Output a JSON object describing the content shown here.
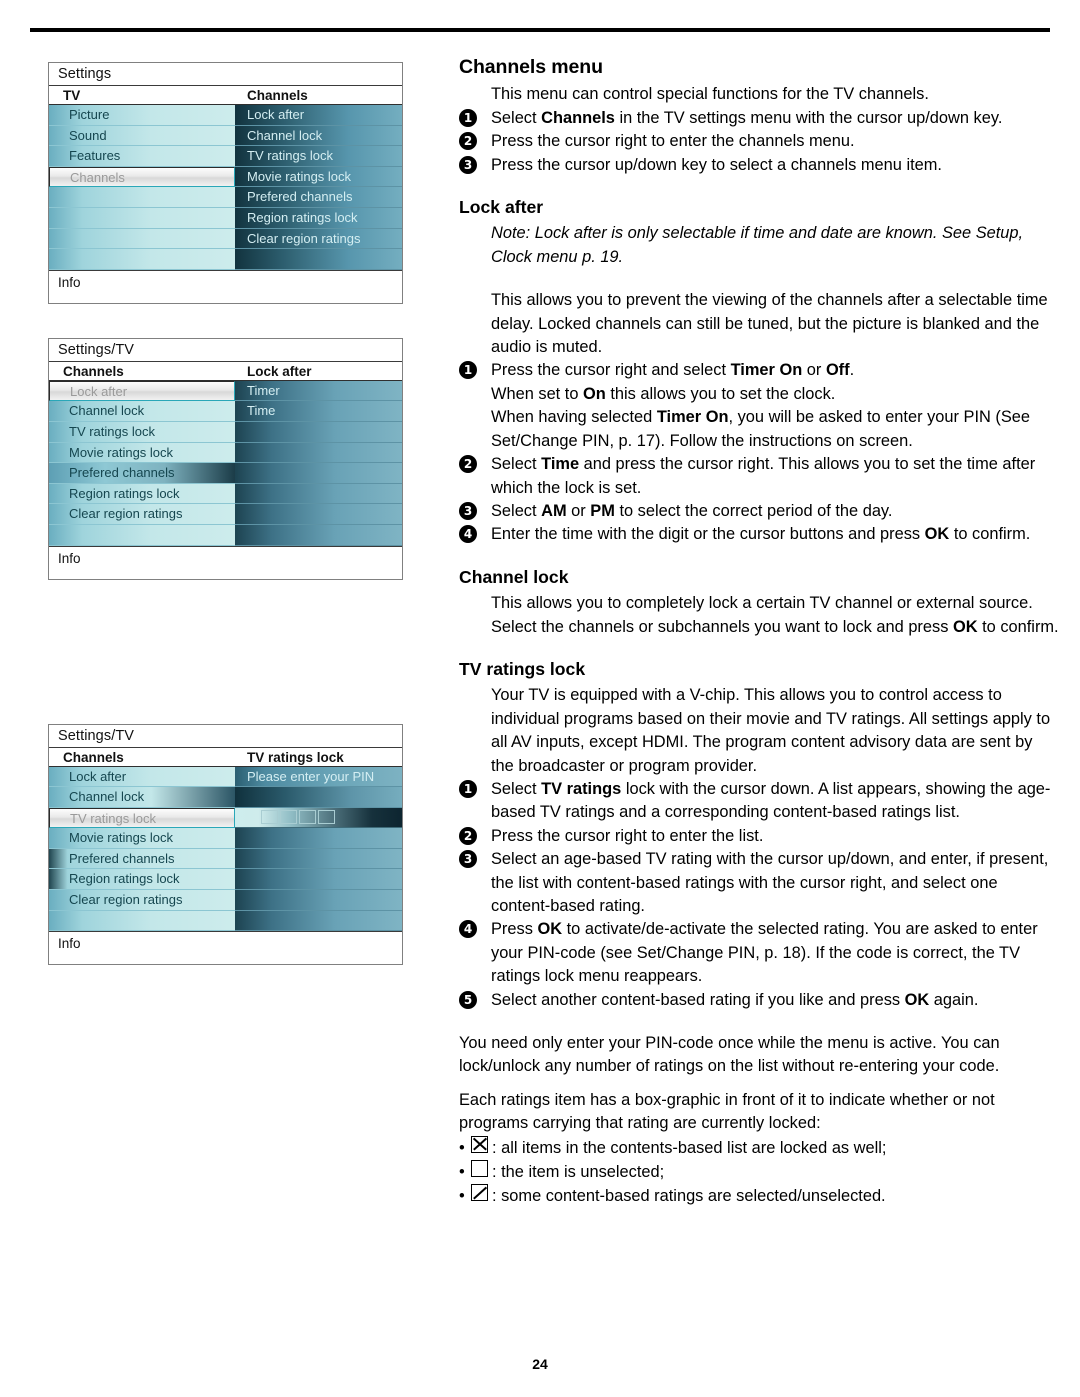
{
  "page": {
    "number": "24"
  },
  "menus": [
    {
      "name": "settings-channels",
      "title": "Settings",
      "left": {
        "header": "TV",
        "items": [
          {
            "label": "Picture",
            "selected": false
          },
          {
            "label": "Sound",
            "selected": false
          },
          {
            "label": "Features",
            "selected": false
          },
          {
            "label": "Channels",
            "selected": true
          },
          {
            "label": "",
            "selected": false
          },
          {
            "label": "",
            "selected": false
          },
          {
            "label": "",
            "selected": false
          },
          {
            "label": "",
            "selected": false
          }
        ]
      },
      "right": {
        "header": "Channels",
        "items": [
          {
            "label": "Lock after"
          },
          {
            "label": "Channel lock"
          },
          {
            "label": "TV ratings lock"
          },
          {
            "label": "Movie ratings lock"
          },
          {
            "label": "Prefered channels"
          },
          {
            "label": "Region ratings lock"
          },
          {
            "label": "Clear region ratings"
          },
          {
            "label": ""
          }
        ]
      },
      "info": "Info"
    },
    {
      "name": "settings-tv-lock-after",
      "title": "Settings/TV",
      "left": {
        "header": "Channels",
        "items": [
          {
            "label": "Lock after",
            "selected": true
          },
          {
            "label": "Channel lock",
            "selected": false
          },
          {
            "label": "TV ratings lock",
            "selected": false
          },
          {
            "label": "Movie ratings lock",
            "selected": false
          },
          {
            "label": "Prefered channels",
            "selected": false
          },
          {
            "label": "Region ratings lock",
            "selected": false
          },
          {
            "label": "Clear region ratings",
            "selected": false
          },
          {
            "label": "",
            "selected": false
          }
        ]
      },
      "right": {
        "header": "Lock after",
        "items": [
          {
            "label": "Timer"
          },
          {
            "label": "Time"
          },
          {
            "label": ""
          },
          {
            "label": ""
          },
          {
            "label": ""
          },
          {
            "label": ""
          },
          {
            "label": ""
          },
          {
            "label": ""
          }
        ]
      },
      "info": "Info"
    },
    {
      "name": "settings-tv-ratings-pin",
      "title": "Settings/TV",
      "left": {
        "header": "Channels",
        "items": [
          {
            "label": "Lock after",
            "selected": false
          },
          {
            "label": "Channel lock",
            "selected": false
          },
          {
            "label": "TV ratings lock",
            "selected": true
          },
          {
            "label": "Movie ratings lock",
            "selected": false
          },
          {
            "label": "Prefered channels",
            "selected": false
          },
          {
            "label": "Region ratings lock",
            "selected": false
          },
          {
            "label": "Clear region ratings",
            "selected": false
          },
          {
            "label": "",
            "selected": false
          }
        ]
      },
      "right": {
        "header": "TV ratings lock",
        "items": [
          {
            "label": "Please enter your PIN"
          },
          {
            "label": ""
          },
          {
            "label": "",
            "pin": true,
            "pin_digits": 4
          },
          {
            "label": ""
          },
          {
            "label": ""
          },
          {
            "label": ""
          },
          {
            "label": ""
          },
          {
            "label": ""
          }
        ]
      },
      "info": "Info"
    }
  ],
  "content": {
    "heading": "Channels menu",
    "intro": "This menu can control special functions for the TV channels.",
    "intro_steps": [
      {
        "n": "1",
        "html": "Select <b>Channels</b> in the TV settings menu with the cursor up/down key."
      },
      {
        "n": "2",
        "html": "Press the cursor right to enter the channels menu."
      },
      {
        "n": "3",
        "html": "Press the cursor up/down key to select a channels menu item."
      }
    ],
    "lock_after": {
      "heading": "Lock after",
      "note": "Note: Lock after is only selectable if time and date are known. See Setup, Clock menu p. 19.",
      "body": "This allows you to prevent the viewing of the channels after a selectable time delay. Locked channels can still be tuned, but the picture is blanked and the audio is muted.",
      "steps": [
        {
          "n": "1",
          "html": "Press the cursor right and select <b>Timer On</b> or <b>Off</b>.<br>When set to <b>On</b> this allows you to set the clock.<br>When having selected <b>Timer On</b>, you will be asked to enter your PIN (See Set/Change PIN, p. 17). Follow the instructions on screen."
        },
        {
          "n": "2",
          "html": "Select <b>Time</b> and press the cursor right. This allows you to set the time after which the lock is set."
        },
        {
          "n": "3",
          "html": "Select <b>AM</b> or <b>PM</b> to select the correct period of the day."
        },
        {
          "n": "4",
          "html": "Enter the time with the digit or the cursor buttons and press <b>OK</b> to confirm."
        }
      ]
    },
    "channel_lock": {
      "heading": "Channel lock",
      "body_html": "This allows you to completely lock a certain TV channel or external source. Select the channels or subchannels you want to lock and press <b>OK</b> to confirm."
    },
    "tv_ratings_lock": {
      "heading": "TV ratings lock",
      "body": "Your TV is equipped with a V-chip. This allows you to control access to individual programs based on their movie and TV ratings. All settings apply to all AV inputs, except HDMI. The program content advisory data are sent by the broadcaster or program provider.",
      "steps": [
        {
          "n": "1",
          "html": "Select <b>TV ratings</b> lock with the cursor down. A list appears, showing the age-based TV ratings and a corresponding content-based ratings list."
        },
        {
          "n": "2",
          "html": "Press the cursor right to enter the list."
        },
        {
          "n": "3",
          "html": "Select an age-based TV rating with the cursor up/down, and enter, if present, the list with content-based ratings with the cursor right, and select one content-based rating."
        },
        {
          "n": "4",
          "html": "Press <b>OK</b> to activate/de-activate the selected rating. You are asked to enter your PIN-code (see Set/Change PIN, p. 18). If the code is correct, the TV ratings lock menu reappears."
        },
        {
          "n": "5",
          "html": "Select another content-based rating if you like and press <b>OK</b> again."
        }
      ],
      "closing1": "You need only enter your PIN-code once while the menu is active. You can lock/unlock any number of ratings on the list without re-entering your code.",
      "closing2": "Each ratings item has a box-graphic in front of it to indicate whether or not programs carrying that rating are currently locked:",
      "box_items": [
        {
          "glyph": "x",
          "text": ": all items in the contents-based list are locked as well;"
        },
        {
          "glyph": "empty",
          "text": ": the item is unselected;"
        },
        {
          "glyph": "slash",
          "text": ": some content-based ratings are selected/unselected."
        }
      ]
    }
  }
}
